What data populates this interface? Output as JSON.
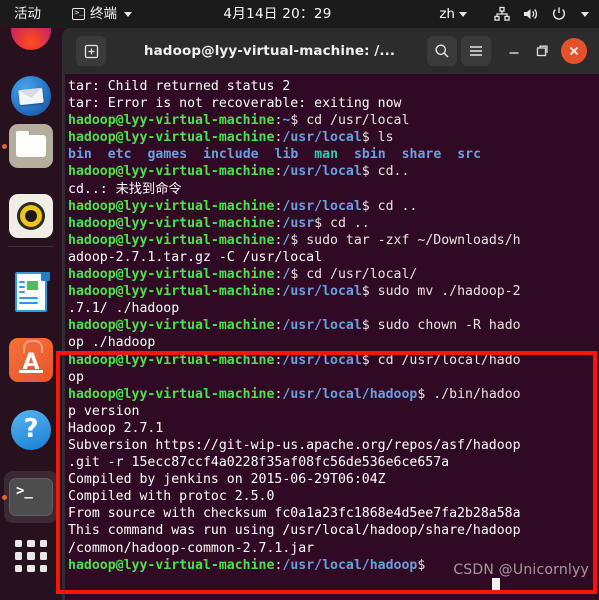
{
  "topbar": {
    "activities": "活动",
    "app_menu_label": "终端",
    "app_menu_icon": "terminal-icon",
    "clock": "4月14日  20：29",
    "language": "zh",
    "tray": [
      {
        "name": "network-icon",
        "label": "network"
      },
      {
        "name": "volume-icon",
        "label": "volume"
      },
      {
        "name": "power-icon",
        "label": "power"
      },
      {
        "name": "chevron-down-icon",
        "label": "menu"
      }
    ]
  },
  "dock": {
    "items": [
      {
        "name": "firefox",
        "label": "Firefox",
        "running": false
      },
      {
        "name": "thunderbird",
        "label": "Thunderbird Mail",
        "running": false
      },
      {
        "name": "files",
        "label": "Files",
        "running": true
      },
      {
        "name": "rhythmbox",
        "label": "Rhythmbox",
        "running": false
      },
      {
        "name": "libreoffice-writer",
        "label": "LibreOffice Writer",
        "running": false
      },
      {
        "name": "ubuntu-software",
        "label": "Ubuntu Software",
        "running": false
      },
      {
        "name": "help",
        "label": "Help",
        "running": false
      },
      {
        "name": "terminal",
        "label": "Terminal",
        "running": true
      },
      {
        "name": "show-applications",
        "label": "Show Applications",
        "running": false
      }
    ]
  },
  "window": {
    "title": "hadoop@lyy-virtual-machine: /...",
    "buttons": {
      "new_tab": "+",
      "search": "search-icon",
      "menu": "hamburger-icon",
      "minimize": "minimize-icon",
      "maximize": "maximize-icon",
      "close": "close-icon"
    }
  },
  "terminal": {
    "user": "hadoop@lyy-virtual-machine",
    "lines": [
      {
        "type": "plain",
        "text": "tar: Child returned status 2"
      },
      {
        "type": "plain",
        "text": "tar: Error is not recoverable: exiting now"
      },
      {
        "type": "prompt",
        "path": ":~$",
        "cmd": " cd /usr/local"
      },
      {
        "type": "prompt",
        "path": ":/usr/local$",
        "cmd": " ls"
      },
      {
        "type": "ls",
        "entries": [
          "bin",
          "etc",
          "games",
          "include",
          "lib",
          "man",
          "sbin",
          "share",
          "src"
        ],
        "link_index": 5
      },
      {
        "type": "prompt",
        "path": ":/usr/local$",
        "cmd": " cd.."
      },
      {
        "type": "plain",
        "text": "cd..: 未找到命令"
      },
      {
        "type": "prompt",
        "path": ":/usr/local$",
        "cmd": " cd .."
      },
      {
        "type": "prompt",
        "path": ":/usr$",
        "cmd": " cd .."
      },
      {
        "type": "prompt",
        "path": ":/$",
        "cmd": " sudo tar -zxf ~/Downloads/h"
      },
      {
        "type": "plain",
        "text": "adoop-2.7.1.tar.gz -C /usr/local"
      },
      {
        "type": "prompt",
        "path": ":/$",
        "cmd": " cd /usr/local/"
      },
      {
        "type": "prompt",
        "path": ":/usr/local$",
        "cmd": " sudo mv ./hadoop-2"
      },
      {
        "type": "plain",
        "text": ".7.1/ ./hadoop"
      },
      {
        "type": "prompt",
        "path": ":/usr/local$",
        "cmd": " sudo chown -R hado"
      },
      {
        "type": "plain",
        "text": "op ./hadoop"
      },
      {
        "type": "prompt",
        "path": ":/usr/local$",
        "cmd": " cd /usr/local/hado"
      },
      {
        "type": "plain",
        "text": "op"
      },
      {
        "type": "prompt",
        "path": ":/usr/local/hadoop$",
        "cmd": " ./bin/hadoo"
      },
      {
        "type": "plain",
        "text": "p version"
      },
      {
        "type": "plain",
        "text": "Hadoop 2.7.1"
      },
      {
        "type": "plain",
        "text": "Subversion https://git-wip-us.apache.org/repos/asf/hadoop"
      },
      {
        "type": "plain",
        "text": ".git -r 15ecc87ccf4a0228f35af08fc56de536e6ce657a"
      },
      {
        "type": "plain",
        "text": "Compiled by jenkins on 2015-06-29T06:04Z"
      },
      {
        "type": "plain",
        "text": "Compiled with protoc 2.5.0"
      },
      {
        "type": "plain",
        "text": "From source with checksum fc0a1a23fc1868e4d5ee7fa2b28a58a"
      },
      {
        "type": "plain",
        "text": "This command was run using /usr/local/hadoop/share/hadoop"
      },
      {
        "type": "plain",
        "text": "/common/hadoop-common-2.7.1.jar"
      },
      {
        "type": "prompt",
        "path": ":/usr/local/hadoop$",
        "cmd": ""
      }
    ]
  },
  "annotation": {
    "highlight_color": "#fc1505",
    "watermark": "CSDN @Unicornlyy"
  }
}
